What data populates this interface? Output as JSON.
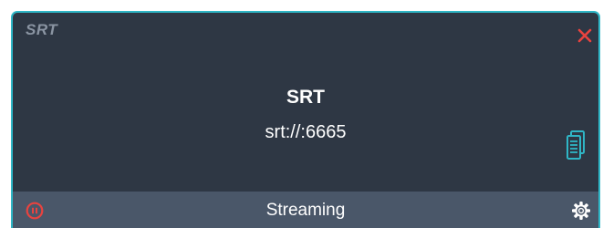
{
  "header": {
    "protocol_label": "SRT",
    "close_icon": "close-icon"
  },
  "stream": {
    "name": "SRT",
    "url": "srt://:6665",
    "copy_icon": "copy-icon"
  },
  "status": {
    "label": "Streaming",
    "pause_icon": "pause-icon",
    "settings_icon": "gear-icon"
  },
  "colors": {
    "panel_bg": "#2e3744",
    "status_bar_bg": "#4a5769",
    "border_accent": "#2fb6c6",
    "close_red": "#e8433f",
    "pause_red": "#e8433f",
    "copy_cyan": "#2fb6c6",
    "text_white": "#ffffff",
    "muted_title": "#8a94a2"
  }
}
